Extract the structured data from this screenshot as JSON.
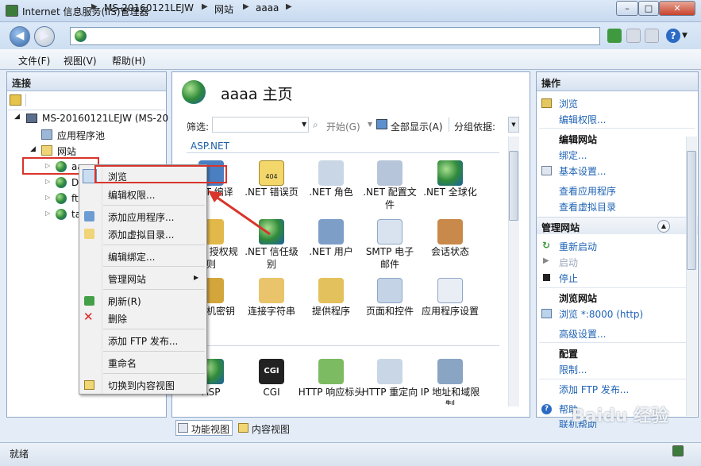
{
  "window": {
    "title": "Internet 信息服务(IIS)管理器",
    "minimize": "–",
    "maximize": "□",
    "close": "✕"
  },
  "address": {
    "segments": [
      "MS-20160121LEJW",
      "网站",
      "aaaa"
    ],
    "arrows": [
      "▶",
      "▶",
      "▶",
      "▶"
    ]
  },
  "menu": {
    "file": "文件(F)",
    "view": "视图(V)",
    "help": "帮助(H)"
  },
  "connections": {
    "title": "连接",
    "tree": {
      "server": "MS-20160121LEJW (MS-20",
      "app_pools": "应用程序池",
      "sites": "网站",
      "site1": "aaaa",
      "site2": "D",
      "site3": "ft",
      "site4": "ta"
    }
  },
  "context_menu": {
    "items": [
      "浏览",
      "编辑权限...",
      "添加应用程序...",
      "添加虚拟目录...",
      "编辑绑定...",
      "管理网站",
      "刷新(R)",
      "删除",
      "添加 FTP 发布...",
      "重命名",
      "切换到内容视图"
    ],
    "submenu_arrow": "▶"
  },
  "main": {
    "title": "aaaa 主页",
    "filter_label": "筛选:",
    "start_label": "开始(G)",
    "show_all_label": "全部显示(A)",
    "group_by_label": "分组依据:",
    "section_aspnet": "ASP.NET",
    "features": [
      ".NET 编译",
      ".NET 错误页",
      ".NET 角色",
      ".NET 配置文件",
      ".NET 全球化",
      ".NET 授权规则",
      ".NET 信任级别",
      ".NET 用户",
      "SMTP 电子邮件",
      "会话状态",
      "计算机密钥",
      "连接字符串",
      "提供程序",
      "页面和控件",
      "应用程序设置",
      "ASP",
      "CGI",
      "HTTP 响应标头",
      "HTTP 重定向",
      "IP 地址和域限制"
    ],
    "icon_404_text": "404",
    "icon_cgi_text": "CGI",
    "feature_view_tab": "功能视图",
    "content_view_tab": "内容视图"
  },
  "actions": {
    "title": "操作",
    "browse": "浏览",
    "edit_permissions": "编辑权限...",
    "edit_site_head": "编辑网站",
    "bindings": "绑定...",
    "basic_settings": "基本设置...",
    "view_apps": "查看应用程序",
    "view_vdirs": "查看虚拟目录",
    "manage_site_head": "管理网站",
    "restart": "重新启动",
    "start": "启动",
    "stop": "停止",
    "browse_site_head": "浏览网站",
    "browse_port": "浏览 *:8000 (http)",
    "advanced_settings": "高级设置...",
    "config_head": "配置",
    "limits": "限制...",
    "add_ftp": "添加 FTP 发布...",
    "help": "帮助",
    "online_help": "联机帮助"
  },
  "status": {
    "text": "就绪"
  },
  "watermark": "Baidu 经验",
  "colors": {
    "accent_link": "#1f63b4",
    "highlight_red": "#d9342b"
  }
}
